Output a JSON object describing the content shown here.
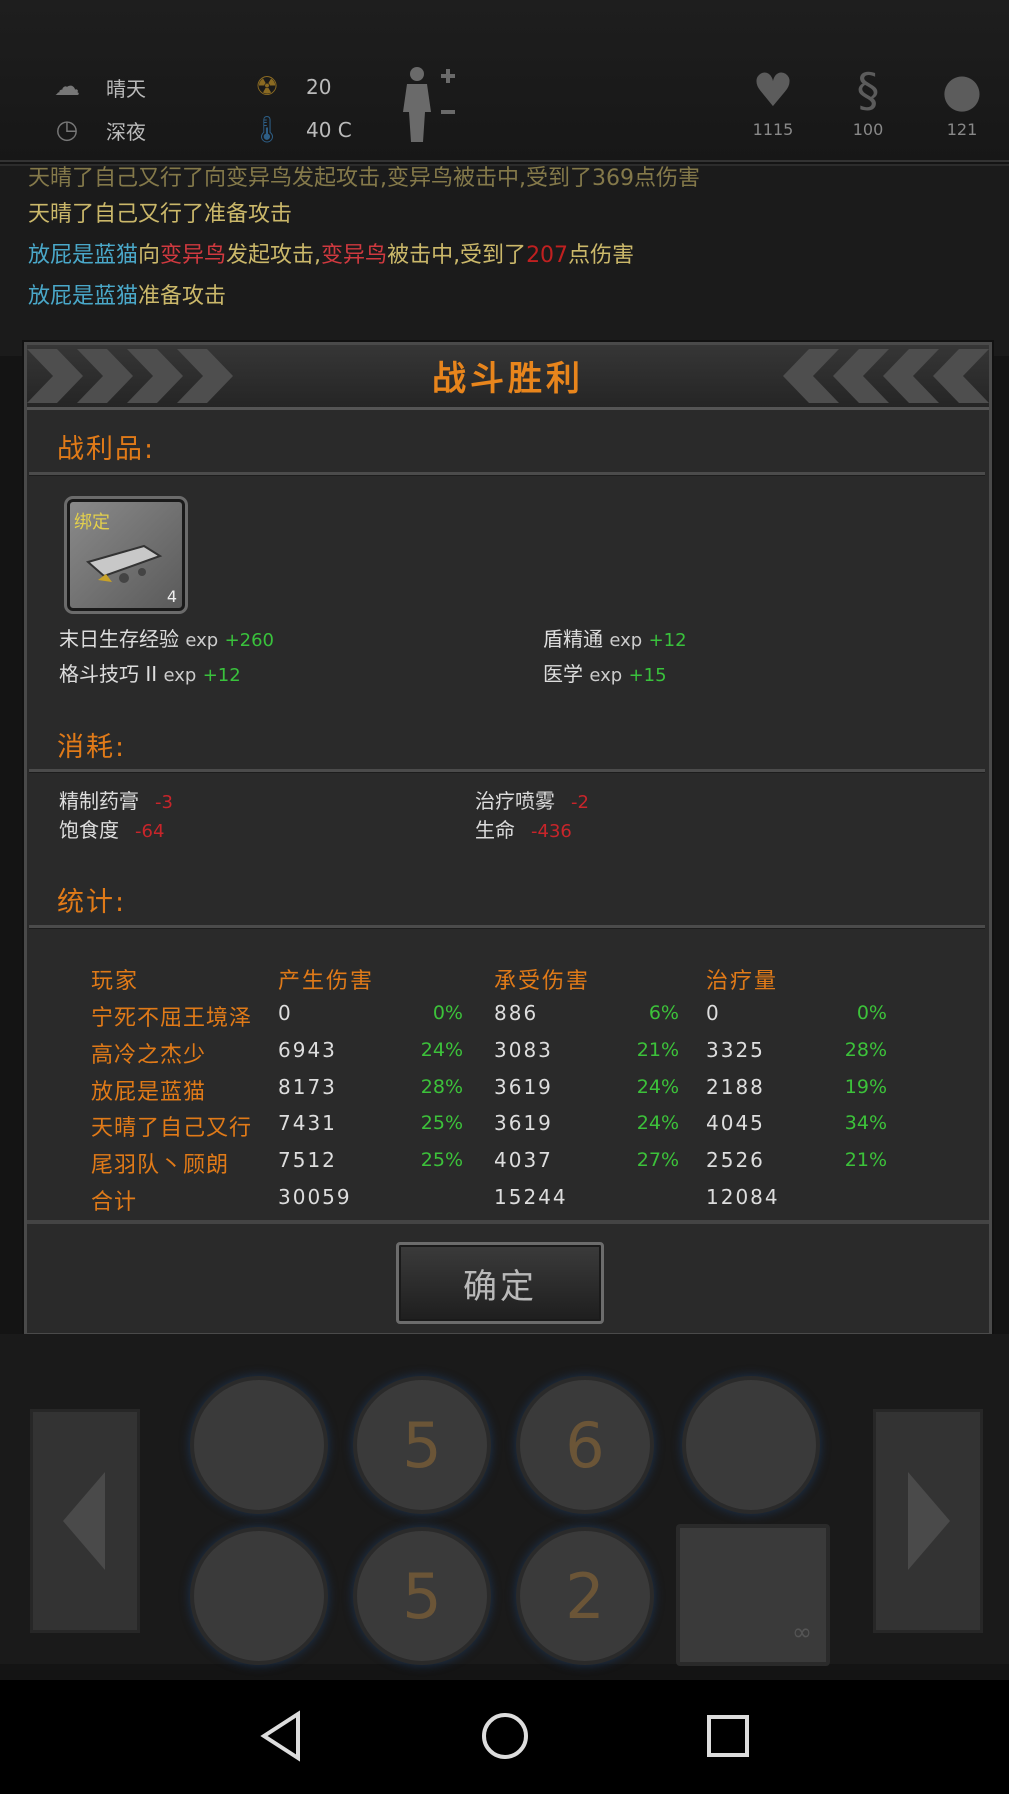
{
  "status": {
    "weather": "晴天",
    "time_of_day": "深夜",
    "radiation": "20",
    "temperature": "40 C",
    "meters": [
      {
        "icon": "heart-icon",
        "value": "1115"
      },
      {
        "icon": "stomach-icon",
        "value": "100"
      },
      {
        "icon": "brain-icon",
        "value": "121"
      }
    ]
  },
  "log": {
    "line1": "天晴了自己又行了向变异鸟发起攻击,变异鸟被击中,受到了369点伤害",
    "line2": "天晴了自己又行了准备攻击",
    "line3": {
      "actor": "放屁是蓝猫",
      "t1": "向",
      "enemy1": "变异鸟",
      "t2": "发起攻击,",
      "enemy2": "变异鸟",
      "t3": "被击中,受到了",
      "damage": "207",
      "t4": "点伤害"
    },
    "line4": {
      "actor": "放屁是蓝猫",
      "text": "准备攻击"
    }
  },
  "dialog": {
    "title": "战斗胜利",
    "loot_title": "战利品:",
    "loot_item": {
      "tag": "绑定",
      "count": "4"
    },
    "exp_gains": [
      {
        "skill": "末日生存经验",
        "exp": "exp",
        "gain": "+260"
      },
      {
        "skill": "盾精通",
        "exp": "exp",
        "gain": "+12"
      },
      {
        "skill": "格斗技巧 II",
        "exp": "exp",
        "gain": "+12"
      },
      {
        "skill": "医学",
        "exp": "exp",
        "gain": "+15"
      }
    ],
    "cost_title": "消耗:",
    "costs": [
      {
        "name": "精制药膏",
        "value": "-3"
      },
      {
        "name": "治疗喷雾",
        "value": "-2"
      },
      {
        "name": "饱食度",
        "value": "-64"
      },
      {
        "name": "生命",
        "value": "-436"
      }
    ],
    "stats_title": "统计:",
    "table": {
      "headers": [
        "玩家",
        "产生伤害",
        "承受伤害",
        "治疗量"
      ],
      "rows": [
        {
          "player": "宁死不屈王境泽",
          "dmg": "0",
          "dmg_pct": "0%",
          "taken": "886",
          "taken_pct": "6%",
          "heal": "0",
          "heal_pct": "0%"
        },
        {
          "player": "高冷之杰少",
          "dmg": "6943",
          "dmg_pct": "24%",
          "taken": "3083",
          "taken_pct": "21%",
          "heal": "3325",
          "heal_pct": "28%"
        },
        {
          "player": "放屁是蓝猫",
          "dmg": "8173",
          "dmg_pct": "28%",
          "taken": "3619",
          "taken_pct": "24%",
          "heal": "2188",
          "heal_pct": "19%"
        },
        {
          "player": "天晴了自己又行",
          "dmg": "7431",
          "dmg_pct": "25%",
          "taken": "3619",
          "taken_pct": "24%",
          "heal": "4045",
          "heal_pct": "34%"
        },
        {
          "player": "尾羽队丶顾朗",
          "dmg": "7512",
          "dmg_pct": "25%",
          "taken": "4037",
          "taken_pct": "27%",
          "heal": "2526",
          "heal_pct": "21%"
        }
      ],
      "total": {
        "label": "合计",
        "dmg": "30059",
        "taken": "15244",
        "heal": "12084"
      }
    },
    "confirm": "确定"
  },
  "skills": {
    "row1": [
      {
        "icon": "slash-skill-icon",
        "count": ""
      },
      {
        "icon": "stab-skill-icon",
        "count": "5"
      },
      {
        "icon": "skull-skill-icon",
        "count": "6"
      },
      {
        "icon": "target-skill-icon",
        "count": ""
      }
    ],
    "row2": [
      {
        "icon": "medkit-skill-icon",
        "count": ""
      },
      {
        "icon": "fire-skill-icon",
        "count": "5"
      },
      {
        "icon": "heal-skill-icon",
        "count": "2"
      },
      {
        "icon": "knife-weapon-icon",
        "count": "∞"
      }
    ]
  }
}
